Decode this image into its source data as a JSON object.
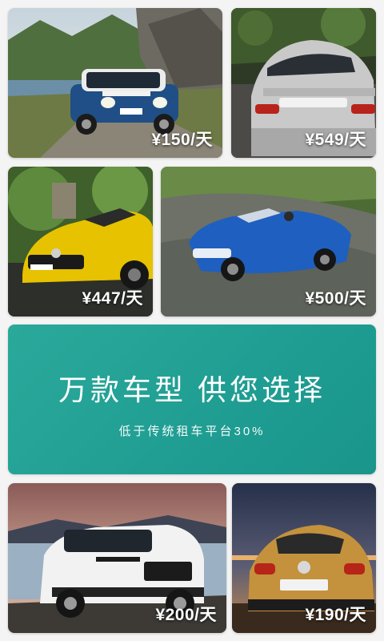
{
  "cars": [
    {
      "name": "mini-countryman",
      "price": "¥150/天",
      "color": "#1f4f86"
    },
    {
      "name": "porsche-911",
      "price": "¥549/天",
      "color": "#c9c9c9"
    },
    {
      "name": "mercedes-amg-gt",
      "price": "¥447/天",
      "color": "#e6c200"
    },
    {
      "name": "bmw-4-convertible",
      "price": "¥500/天",
      "color": "#1f5fbf"
    },
    {
      "name": "jeep-cherokee",
      "price": "¥200/天",
      "color": "#f2f2f2"
    },
    {
      "name": "vw-beetle-dune",
      "price": "¥190/天",
      "color": "#c4913c"
    }
  ],
  "banner": {
    "title": "万款车型 供您选择",
    "subtitle": "低于传统租车平台30%",
    "color": "#26a396"
  }
}
